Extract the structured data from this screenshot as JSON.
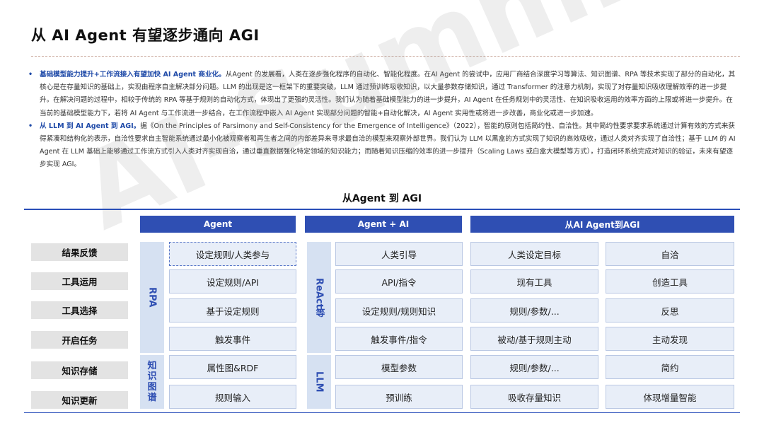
{
  "title": "从 AI Agent 有望逐步通向 AGI",
  "bullets": [
    {
      "lead": "基础模型能力提升+工作流接入有望加快 AI Agent 商业化。",
      "text": "从Agent 的发展看，人类在逐步强化程序的自动化、智能化程度。在AI Agent 的尝试中，应用厂商结合深度学习等算法、知识图谱、RPA 等技术实现了部分的自动化，其核心是在存量知识的基础上，实现由程序自主解决部分问题。LLM 的出现是这一框架下的重要突破，LLM 通过预训练吸收知识，以大量参数存储知识，通过 Transformer 的注意力机制，实现了对存量知识吸收理解效率的进一步提升。在解决问题的过程中，相较于传统的 RPA 等基于规则的自动化方式，体现出了更强的灵活性。我们认为随着基础模型能力的进一步提升，AI Agent 在任务规划中的灵活性、在知识吸收运用的效率方面的上限或将进一步提升。在当前的基础模型能力下，若将 AI Agent 与工作流进一步结合，在工作流程中嵌入 AI Agent 实现部分问题的智能+自动化解决，AI Agent 实用性或将进一步改善，商业化或进一步加速。"
    },
    {
      "lead": "从 LLM 到 AI Agent 到 AGI。",
      "text": "据《On the Principles of Parsimony and Self-Consistency for the Emergence of Intelligence》（2022），智能的原则包括简约性、自洽性。其中简约性要求要求系统通过计算有效的方式来获得紧凑和结构化的表示，自洽性要求自主智能系统通过最小化被观察者和再生者之间的内部差异来寻求最自洽的模型来观察外部世界。我们认为 LLM 以黑盒的方式实现了知识的高效吸收，通过人类对齐实现了自洽性；基于 LLM 的 AI Agent 在 LLM 基础上能够通过工作流方式引入人类对齐实现自洽，通过垂直数据强化特定领域的知识能力；而随着知识压缩的效率的进一步提升（Scaling Laws 或白盒大模型等方式），打造闭环系统完成对知识的验证，未来有望逐步实现 AGI。"
    }
  ],
  "watermark": "AI-Summit",
  "diagram": {
    "title": "从Agent 到 AGI",
    "headers": [
      "Agent",
      "Agent + AI",
      "从AI Agent到AGI"
    ],
    "row_labels": [
      "结果反馈",
      "工具运用",
      "工具选择",
      "开启任务",
      "知识存储",
      "知识更新"
    ],
    "side_labels": {
      "rpa": "RPA",
      "react": "ReAct等",
      "kg": [
        "知",
        "识",
        "图",
        "谱"
      ],
      "llm": "LLM"
    },
    "col_agent": [
      "设定规则/人类参与",
      "设定规则/API",
      "基于设定规则",
      "触发事件",
      "属性图&RDF",
      "规则输入"
    ],
    "col_agent_ai": [
      "人类引导",
      "API/指令",
      "设定规则/规则知识",
      "触发事件/指令",
      "模型参数",
      "预训练"
    ],
    "col_agi_left": [
      "人类设定目标",
      "现有工具",
      "规则/参数/...",
      "被动/基于规则主动",
      "规则/参数/...",
      "吸收存量知识"
    ],
    "col_agi_right": [
      "自洽",
      "创造工具",
      "反思",
      "主动发现",
      "简约",
      "体现增量智能"
    ]
  },
  "colors": {
    "accent": "#2f4fb3",
    "cell_fill": "#e8eef8",
    "side_fill": "#d6e1f2",
    "label_fill": "#e3e3e3"
  }
}
